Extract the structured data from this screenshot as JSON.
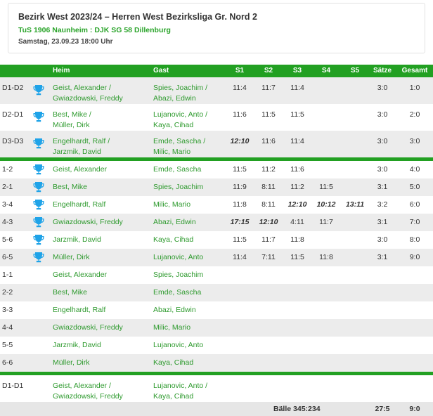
{
  "header": {
    "title": "Bezirk West 2023/24 – Herren West Bezirksliga Gr. Nord 2",
    "teams": "TuS 1906 Naunheim : DJK SG 58 Dillenburg",
    "date": "Samstag, 23.09.23 18:00 Uhr"
  },
  "columns": {
    "heim": "Heim",
    "gast": "Gast",
    "s1": "S1",
    "s2": "S2",
    "s3": "S3",
    "s4": "S4",
    "s5": "S5",
    "saetze": "Sätze",
    "gesamt": "Gesamt"
  },
  "doubles": [
    {
      "id": "D1-D2",
      "heim1": "Geist, Alexander /",
      "heim2": "Gwiazdowski, Freddy",
      "gast1": "Spies, Joachim /",
      "gast2": "Abazi, Edwin",
      "s1": "11:4",
      "s2": "11:7",
      "s3": "11:4",
      "s4": "",
      "s5": "",
      "saetze": "3:0",
      "gesamt": "1:0"
    },
    {
      "id": "D2-D1",
      "heim1": "Best, Mike /",
      "heim2": "Müller, Dirk",
      "gast1": "Lujanovic, Anto /",
      "gast2": "Kaya, Cihad",
      "s1": "11:6",
      "s2": "11:5",
      "s3": "11:5",
      "s4": "",
      "s5": "",
      "saetze": "3:0",
      "gesamt": "2:0"
    },
    {
      "id": "D3-D3",
      "heim1": "Engelhardt, Ralf /",
      "heim2": "Jarzmik, David",
      "gast1": "Emde, Sascha /",
      "gast2": "Milic, Mario",
      "s1": "12:10",
      "s2": "11:6",
      "s3": "11:4",
      "s4": "",
      "s5": "",
      "saetze": "3:0",
      "gesamt": "3:0"
    }
  ],
  "singles": [
    {
      "id": "1-2",
      "heim": "Geist, Alexander",
      "gast": "Emde, Sascha",
      "s1": "11:5",
      "s2": "11:2",
      "s3": "11:6",
      "s4": "",
      "s5": "",
      "saetze": "3:0",
      "gesamt": "4:0"
    },
    {
      "id": "2-1",
      "heim": "Best, Mike",
      "gast": "Spies, Joachim",
      "s1": "11:9",
      "s2": "8:11",
      "s3": "11:2",
      "s4": "11:5",
      "s5": "",
      "saetze": "3:1",
      "gesamt": "5:0"
    },
    {
      "id": "3-4",
      "heim": "Engelhardt, Ralf",
      "gast": "Milic, Mario",
      "s1": "11:8",
      "s2": "8:11",
      "s3": "12:10",
      "s4": "10:12",
      "s5": "13:11",
      "saetze": "3:2",
      "gesamt": "6:0"
    },
    {
      "id": "4-3",
      "heim": "Gwiazdowski, Freddy",
      "gast": "Abazi, Edwin",
      "s1": "17:15",
      "s2": "12:10",
      "s3": "4:11",
      "s4": "11:7",
      "s5": "",
      "saetze": "3:1",
      "gesamt": "7:0"
    },
    {
      "id": "5-6",
      "heim": "Jarzmik, David",
      "gast": "Kaya, Cihad",
      "s1": "11:5",
      "s2": "11:7",
      "s3": "11:8",
      "s4": "",
      "s5": "",
      "saetze": "3:0",
      "gesamt": "8:0"
    },
    {
      "id": "6-5",
      "heim": "Müller, Dirk",
      "gast": "Lujanovic, Anto",
      "s1": "11:4",
      "s2": "7:11",
      "s3": "11:5",
      "s4": "11:8",
      "s5": "",
      "saetze": "3:1",
      "gesamt": "9:0"
    },
    {
      "id": "1-1",
      "heim": "Geist, Alexander",
      "gast": "Spies, Joachim"
    },
    {
      "id": "2-2",
      "heim": "Best, Mike",
      "gast": "Emde, Sascha"
    },
    {
      "id": "3-3",
      "heim": "Engelhardt, Ralf",
      "gast": "Abazi, Edwin"
    },
    {
      "id": "4-4",
      "heim": "Gwiazdowski, Freddy",
      "gast": "Milic, Mario"
    },
    {
      "id": "5-5",
      "heim": "Jarzmik, David",
      "gast": "Lujanovic, Anto"
    },
    {
      "id": "6-6",
      "heim": "Müller, Dirk",
      "gast": "Kaya, Cihad"
    }
  ],
  "final_double": {
    "id": "D1-D1",
    "heim1": "Geist, Alexander /",
    "heim2": "Gwiazdowski, Freddy",
    "gast1": "Lujanovic, Anto /",
    "gast2": "Kaya, Cihad"
  },
  "footer": {
    "baelle": "Bälle 345:234",
    "saetze": "27:5",
    "gesamt": "9:0"
  },
  "colors": {
    "accent": "#22a022",
    "link": "#2e9a2e",
    "trophy": "#1fa3e8",
    "stripe": "#ececec"
  },
  "icons": {
    "winner": "trophy-icon"
  }
}
